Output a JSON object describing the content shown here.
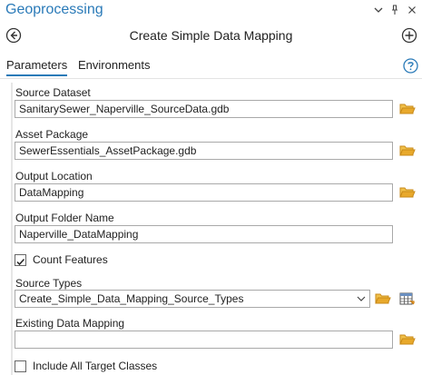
{
  "pane": {
    "title": "Geoprocessing"
  },
  "tool": {
    "title": "Create Simple Data Mapping"
  },
  "tabs": [
    {
      "label": "Parameters",
      "active": true
    },
    {
      "label": "Environments",
      "active": false
    }
  ],
  "params": {
    "source_dataset": {
      "label": "Source Dataset",
      "value": "SanitarySewer_Naperville_SourceData.gdb"
    },
    "asset_package": {
      "label": "Asset Package",
      "value": "SewerEssentials_AssetPackage.gdb"
    },
    "output_location": {
      "label": "Output Location",
      "value": "DataMapping"
    },
    "output_folder_name": {
      "label": "Output Folder Name",
      "value": "Naperville_DataMapping"
    },
    "count_features": {
      "label": "Count Features",
      "checked": true
    },
    "source_types": {
      "label": "Source Types",
      "value": "Create_Simple_Data_Mapping_Source_Types"
    },
    "existing_data_mapping": {
      "label": "Existing Data Mapping",
      "value": ""
    },
    "include_all_target_classes": {
      "label": "Include All Target Classes",
      "checked": false
    }
  },
  "colors": {
    "accent": "#2a7ab8",
    "folder": "#e8a92c",
    "check": "#2a7ab8"
  },
  "icons": [
    "chevron-down-icon",
    "pin-icon",
    "close-icon",
    "back-icon",
    "add-icon",
    "help-icon",
    "folder-icon",
    "table-icon",
    "checkmark-icon"
  ]
}
